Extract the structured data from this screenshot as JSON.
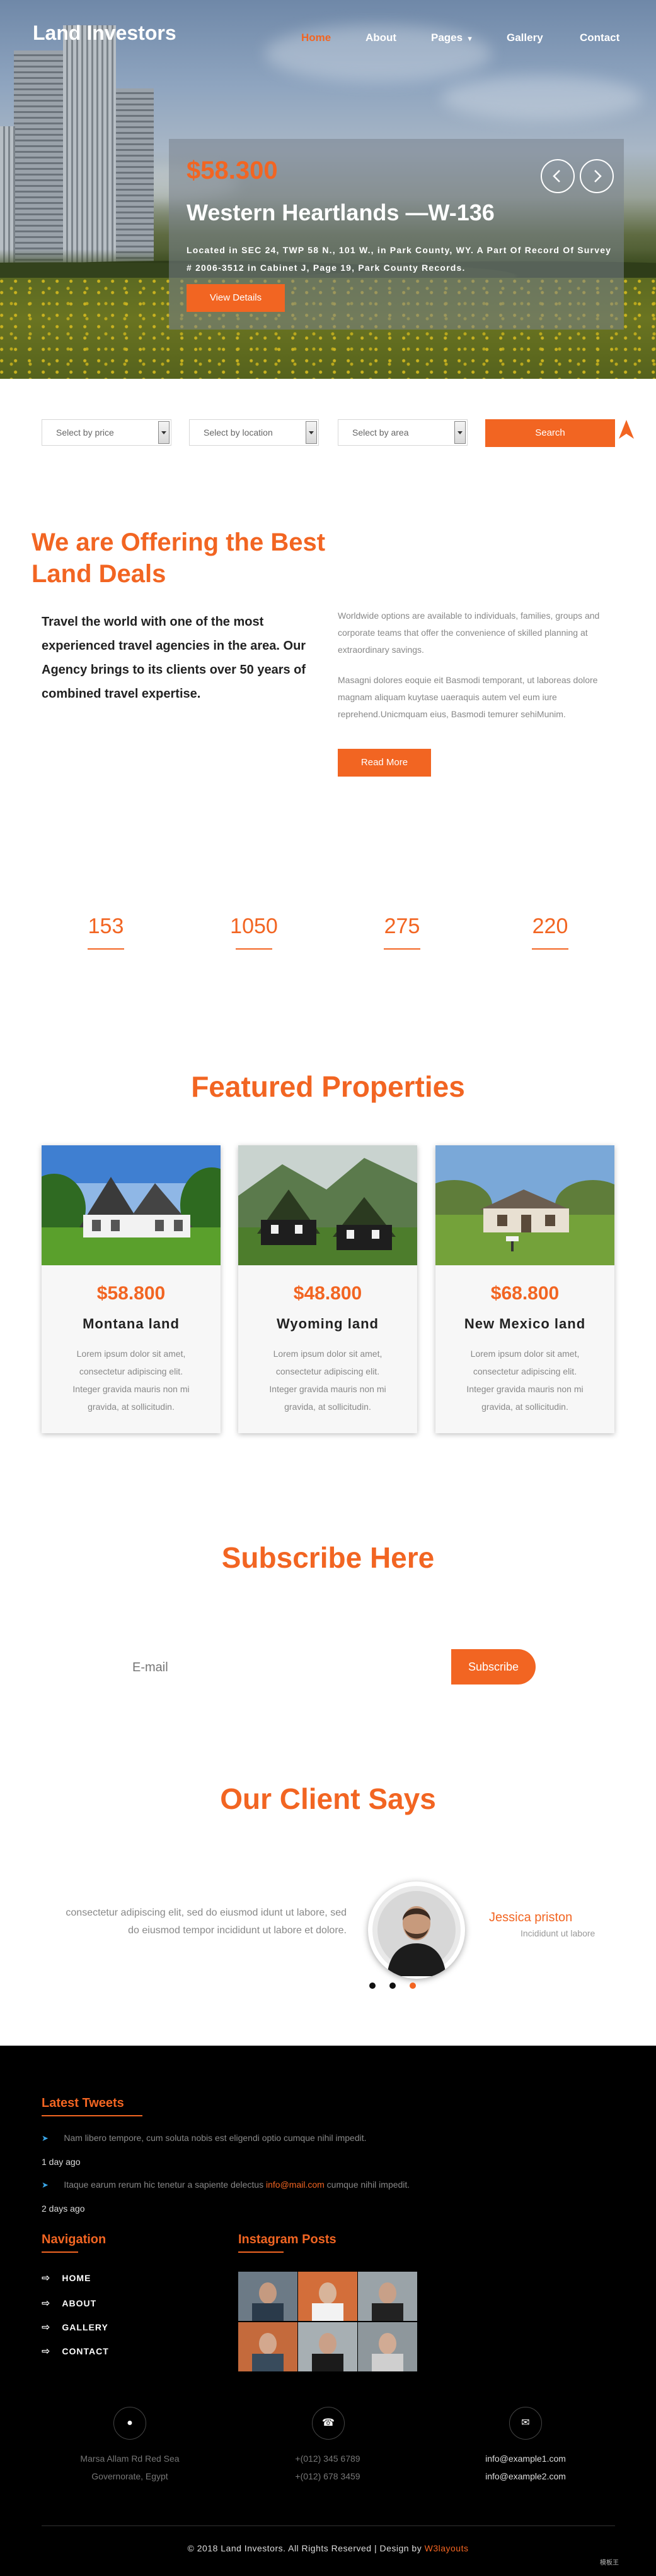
{
  "brand": "Land Investors",
  "nav": {
    "items": [
      {
        "label": "Home",
        "active": true
      },
      {
        "label": "About",
        "active": false
      },
      {
        "label": "Pages",
        "active": false
      },
      {
        "label": "Gallery",
        "active": false
      },
      {
        "label": "Contact",
        "active": false
      }
    ]
  },
  "hero": {
    "price": "$58.300",
    "title": "Western Heartlands —W-136",
    "description": "Located in SEC 24, TWP 58 N., 101 W., in Park County, WY. A Part Of Record Of Survey # 2006-3512 in Cabinet J, Page 19, Park County Records.",
    "button": "View Details"
  },
  "search": {
    "price_placeholder": "Select by price",
    "location_placeholder": "Select by location",
    "area_placeholder": "Select by area",
    "button": "Search"
  },
  "offering": {
    "title": "We are Offering the Best Land Deals",
    "lead": "Travel the world with one of the most experienced travel agencies in the area. Our Agency brings to its clients over 50 years of combined travel expertise.",
    "para1": "Worldwide options are available to individuals, families, groups and corporate teams that offer the convenience of skilled planning at extraordinary savings.",
    "para2": "Masagni dolores eoquie eit Basmodi temporant, ut laboreas dolore magnam aliquam kuytase uaeraquis autem vel eum iure reprehend.Unicmquam eius, Basmodi temurer sehiMunim.",
    "button": "Read More"
  },
  "stats": [
    "153",
    "1050",
    "275",
    "220"
  ],
  "featured": {
    "title": "Featured Properties",
    "cards": [
      {
        "price": "$58.800",
        "name": "Montana land",
        "desc": "Lorem ipsum dolor sit amet, consectetur adipiscing elit. Integer gravida mauris non mi gravida, at sollicitudin."
      },
      {
        "price": "$48.800",
        "name": "Wyoming land",
        "desc": "Lorem ipsum dolor sit amet, consectetur adipiscing elit. Integer gravida mauris non mi gravida, at sollicitudin."
      },
      {
        "price": "$68.800",
        "name": "New Mexico land",
        "desc": "Lorem ipsum dolor sit amet, consectetur adipiscing elit. Integer gravida mauris non mi gravida, at sollicitudin."
      }
    ]
  },
  "subscribe": {
    "title": "Subscribe Here",
    "placeholder": "E-mail",
    "button": "Subscribe"
  },
  "client": {
    "title": "Our Client Says",
    "quote": "consectetur adipiscing elit, sed do eiusmod idunt ut labore, sed do eiusmod tempor incididunt ut labore et dolore.",
    "name": "Jessica priston",
    "role": "Incididunt ut labore"
  },
  "footer": {
    "tweets_title": "Latest Tweets",
    "tweets": [
      {
        "text": "Nam libero tempore, cum soluta nobis est eligendi optio cumque nihil impedit.",
        "time": "1 day ago"
      },
      {
        "text_before": "Itaque earum rerum hic tenetur a sapiente delectus ",
        "link": "info@mail.com",
        "text_after": " cumque nihil impedit.",
        "time": "2 days ago"
      }
    ],
    "nav_title": "Navigation",
    "nav_items": [
      "HOME",
      "ABOUT",
      "GALLERY",
      "CONTACT"
    ],
    "insta_title": "Instagram Posts",
    "address_line1": "Marsa Allam Rd Red Sea",
    "address_line2": "Governorate, Egypt",
    "phone1": "+(012) 345 6789",
    "phone2": "+(012) 678 3459",
    "email1": "info@example1.com",
    "email2": "info@example2.com",
    "copyright_text": "© 2018 Land Investors. All Rights Reserved | Design by ",
    "copyright_link": "W3layouts",
    "watermark": "模板王"
  },
  "colors": {
    "accent": "#f26522",
    "footer_bg": "#000000"
  },
  "icons": [
    "prev-arrow-icon",
    "next-arrow-icon",
    "scroll-arrow-icon",
    "twitter-icon",
    "map-marker-icon",
    "phone-icon",
    "envelope-icon",
    "chevron-icon"
  ]
}
